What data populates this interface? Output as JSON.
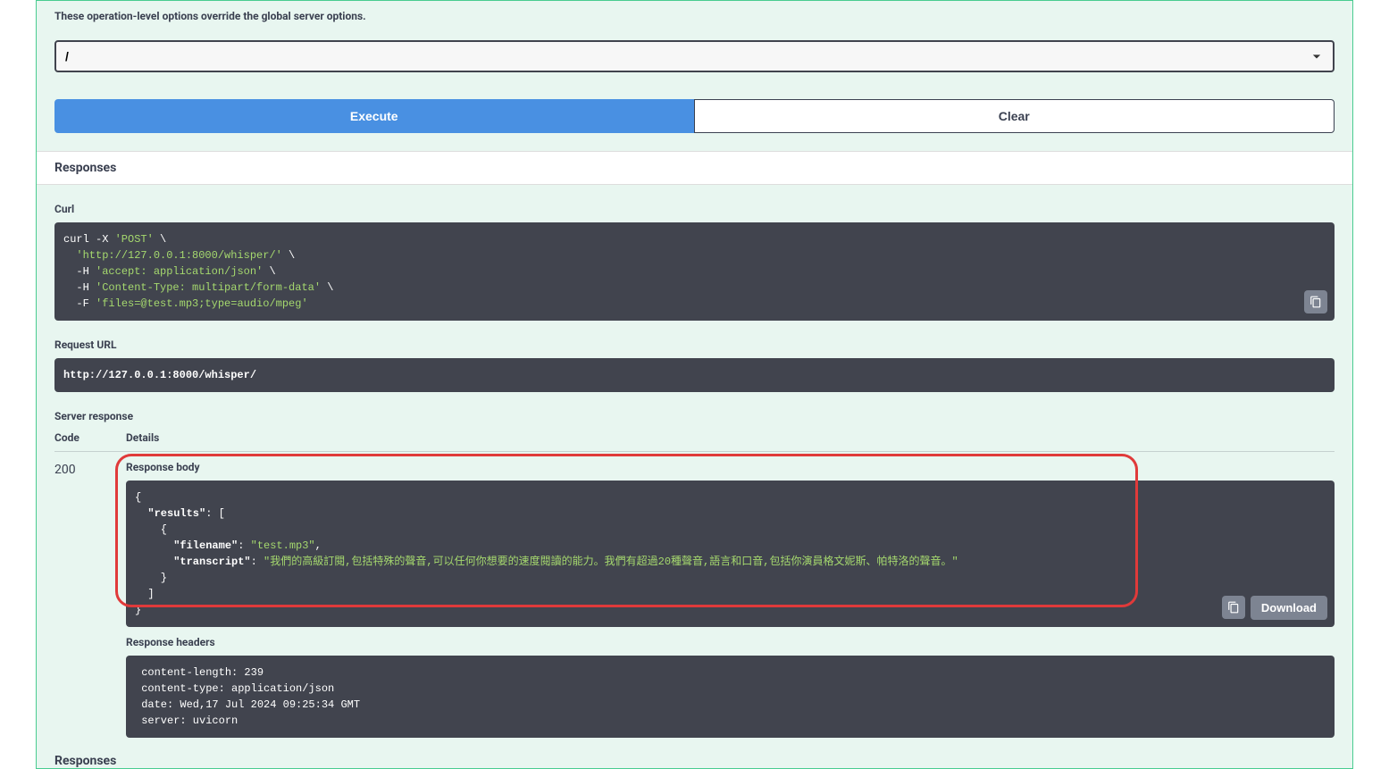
{
  "override_text": "These operation-level options override the global server options.",
  "server_value": "/",
  "buttons": {
    "execute": "Execute",
    "clear": "Clear"
  },
  "responses_heading": "Responses",
  "curl": {
    "label": "Curl",
    "line1a": "curl -X ",
    "line1b": "'POST'",
    "line1c": " \\",
    "line2a": "  ",
    "line2b": "'http://127.0.0.1:8000/whisper/'",
    "line2c": " \\",
    "line3a": "  -H ",
    "line3b": "'accept: application/json'",
    "line3c": " \\",
    "line4a": "  -H ",
    "line4b": "'Content-Type: multipart/form-data'",
    "line4c": " \\",
    "line5a": "  -F ",
    "line5b": "'files=@test.mp3;type=audio/mpeg'"
  },
  "request_url": {
    "label": "Request URL",
    "value": "http://127.0.0.1:8000/whisper/"
  },
  "server_response_label": "Server response",
  "columns": {
    "code": "Code",
    "details": "Details"
  },
  "response": {
    "status": "200",
    "body_label": "Response body",
    "body_l1": "{",
    "body_l2a": "  \"results\"",
    "body_l2b": ": [",
    "body_l3": "    {",
    "body_l4a": "      \"filename\"",
    "body_l4b": ": ",
    "body_l4c": "\"test.mp3\"",
    "body_l4d": ",",
    "body_l5a": "      \"transcript\"",
    "body_l5b": ": ",
    "body_l5c": "\"我們的高級訂閱,包括特殊的聲音,可以任何你想要的速度閱讀的能力。我們有超過20種聲音,語言和口音,包括你演員格文妮斯、帕特洛的聲音。\"",
    "body_l6": "    }",
    "body_l7": "  ]",
    "body_l8": "}",
    "download": "Download",
    "headers_label": "Response headers",
    "headers_text": " content-length: 239 \n content-type: application/json \n date: Wed,17 Jul 2024 09:25:34 GMT \n server: uvicorn "
  },
  "bottom_responses_label": "Responses"
}
